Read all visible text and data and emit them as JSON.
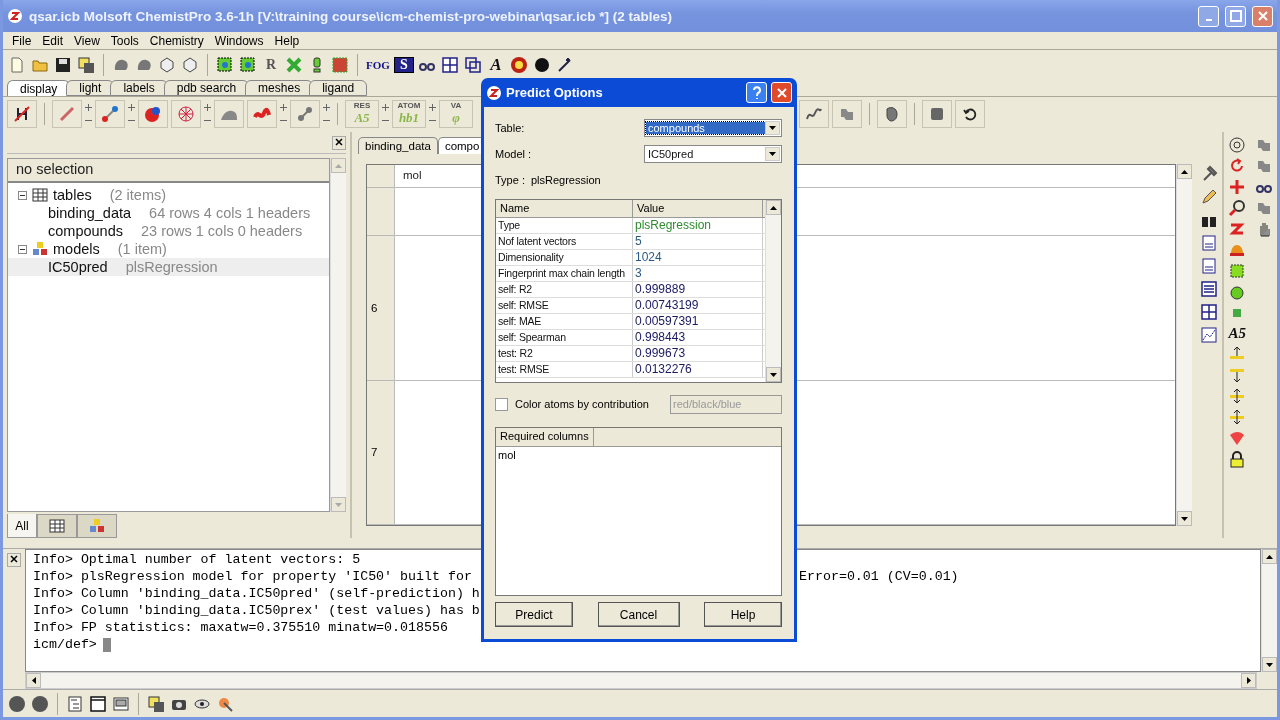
{
  "window": {
    "title": "qsar.icb Molsoft ChemistPro 3.6-1h  [V:\\training course\\icm-chemist-pro-webinar\\qsar.icb *] (2 tables)"
  },
  "menu": [
    "File",
    "Edit",
    "View",
    "Tools",
    "Chemistry",
    "Windows",
    "Help"
  ],
  "toolbar": {
    "text_buttons": [
      "R",
      "FOG",
      "S",
      "A"
    ]
  },
  "display_tabs": [
    {
      "label": "display",
      "selected": true
    },
    {
      "label": "light",
      "selected": false
    },
    {
      "label": "labels",
      "selected": false
    },
    {
      "label": "pdb search",
      "selected": false
    },
    {
      "label": "meshes",
      "selected": false
    },
    {
      "label": "ligand",
      "selected": false
    }
  ],
  "label_buttons": [
    {
      "top": "RES",
      "bottom": "A5"
    },
    {
      "top": "ATOM",
      "bottom": "hb1"
    },
    {
      "top": "VA",
      "bottom": "φ"
    }
  ],
  "workspace": {
    "header": "no selection",
    "tree": [
      {
        "label": "tables",
        "detail": "(2 items)",
        "kind": "tables",
        "expanded": true,
        "selected": false,
        "children": [
          {
            "label": "binding_data",
            "detail": "64 rows 4 cols 1 headers",
            "selected": false
          },
          {
            "label": "compounds",
            "detail": "23 rows 1 cols 0 headers",
            "selected": false
          }
        ]
      },
      {
        "label": "models",
        "detail": "(1 item)",
        "kind": "models",
        "expanded": true,
        "selected": false,
        "children": [
          {
            "label": "IC50pred",
            "detail": "plsRegression",
            "selected": true
          }
        ]
      }
    ],
    "tabs": [
      {
        "kind": "text",
        "label": "All",
        "selected": true
      },
      {
        "kind": "tables",
        "selected": false
      },
      {
        "kind": "models",
        "selected": false
      }
    ]
  },
  "table_view": {
    "tabs": [
      {
        "label": "binding_data",
        "selected": false
      },
      {
        "label": "compo",
        "selected": true
      }
    ],
    "column": "mol",
    "rows": [
      "6",
      "7"
    ]
  },
  "right_toolbar": {
    "label": "A5"
  },
  "dialog": {
    "title": "Predict Options",
    "table_label": "Table:",
    "table_value": "compounds",
    "model_label": "Model :",
    "model_value": "IC50pred",
    "type_label": "Type :",
    "type_value": "plsRegression",
    "grid": {
      "columns": [
        "Name",
        "Value"
      ],
      "rows": [
        {
          "name": "Type",
          "value": "plsRegression",
          "color": "#2e8b2e"
        },
        {
          "name": "Nof latent vectors",
          "value": "5",
          "color": "#2a5a8a"
        },
        {
          "name": "Dimensionality",
          "value": "1024",
          "color": "#2a5a8a"
        },
        {
          "name": "Fingerprint max chain length",
          "value": "3",
          "color": "#2a5a8a"
        },
        {
          "name": "self: R2",
          "value": "0.999889",
          "color": "#1a1a60"
        },
        {
          "name": "self: RMSE",
          "value": "0.00743199",
          "color": "#1a1a60"
        },
        {
          "name": "self: MAE",
          "value": "0.00597391",
          "color": "#1a1a60"
        },
        {
          "name": "self: Spearman",
          "value": "0.998443",
          "color": "#1a1a60"
        },
        {
          "name": "test: R2",
          "value": "0.999673",
          "color": "#1a1a60"
        },
        {
          "name": "test: RMSE",
          "value": "0.0132276",
          "color": "#1a1a60"
        }
      ]
    },
    "color_atoms": {
      "label": "Color atoms by contribution",
      "checked": false
    },
    "color_scheme": {
      "value": "red/black/blue",
      "disabled": true
    },
    "required": {
      "header": "Required columns",
      "items": [
        "mol"
      ]
    },
    "buttons": [
      "Predict",
      "Cancel",
      "Help"
    ]
  },
  "console": {
    "lines": [
      {
        "text": "Info> Optimal number of latent vectors: 5"
      },
      {
        "text": "Info> plsRegression model for property 'IC50' built for",
        "tail": "Error=0.01 (CV=0.01)"
      },
      {
        "text": "Info> Column 'binding_data.IC50pred' (self-prediction) h"
      },
      {
        "text": "Info> Column 'binding_data.IC50prex' (test values) has b"
      },
      {
        "text": "Info> FP statistics: maxatw=0.375510 minatw=0.018556"
      }
    ],
    "prompt": "icm/def>"
  }
}
